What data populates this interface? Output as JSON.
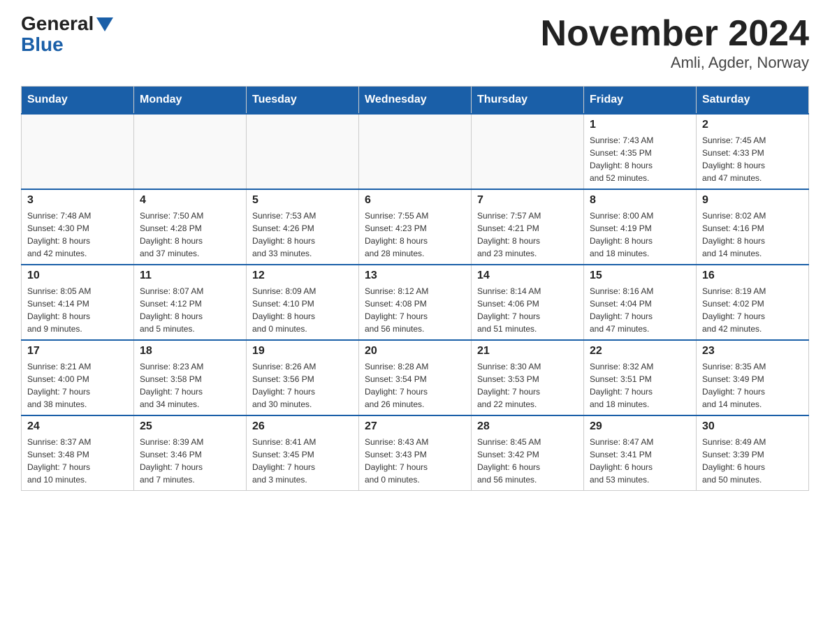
{
  "logo": {
    "general": "General",
    "blue": "Blue"
  },
  "title": "November 2024",
  "subtitle": "Amli, Agder, Norway",
  "days_of_week": [
    "Sunday",
    "Monday",
    "Tuesday",
    "Wednesday",
    "Thursday",
    "Friday",
    "Saturday"
  ],
  "weeks": [
    [
      {
        "day": "",
        "info": ""
      },
      {
        "day": "",
        "info": ""
      },
      {
        "day": "",
        "info": ""
      },
      {
        "day": "",
        "info": ""
      },
      {
        "day": "",
        "info": ""
      },
      {
        "day": "1",
        "info": "Sunrise: 7:43 AM\nSunset: 4:35 PM\nDaylight: 8 hours\nand 52 minutes."
      },
      {
        "day": "2",
        "info": "Sunrise: 7:45 AM\nSunset: 4:33 PM\nDaylight: 8 hours\nand 47 minutes."
      }
    ],
    [
      {
        "day": "3",
        "info": "Sunrise: 7:48 AM\nSunset: 4:30 PM\nDaylight: 8 hours\nand 42 minutes."
      },
      {
        "day": "4",
        "info": "Sunrise: 7:50 AM\nSunset: 4:28 PM\nDaylight: 8 hours\nand 37 minutes."
      },
      {
        "day": "5",
        "info": "Sunrise: 7:53 AM\nSunset: 4:26 PM\nDaylight: 8 hours\nand 33 minutes."
      },
      {
        "day": "6",
        "info": "Sunrise: 7:55 AM\nSunset: 4:23 PM\nDaylight: 8 hours\nand 28 minutes."
      },
      {
        "day": "7",
        "info": "Sunrise: 7:57 AM\nSunset: 4:21 PM\nDaylight: 8 hours\nand 23 minutes."
      },
      {
        "day": "8",
        "info": "Sunrise: 8:00 AM\nSunset: 4:19 PM\nDaylight: 8 hours\nand 18 minutes."
      },
      {
        "day": "9",
        "info": "Sunrise: 8:02 AM\nSunset: 4:16 PM\nDaylight: 8 hours\nand 14 minutes."
      }
    ],
    [
      {
        "day": "10",
        "info": "Sunrise: 8:05 AM\nSunset: 4:14 PM\nDaylight: 8 hours\nand 9 minutes."
      },
      {
        "day": "11",
        "info": "Sunrise: 8:07 AM\nSunset: 4:12 PM\nDaylight: 8 hours\nand 5 minutes."
      },
      {
        "day": "12",
        "info": "Sunrise: 8:09 AM\nSunset: 4:10 PM\nDaylight: 8 hours\nand 0 minutes."
      },
      {
        "day": "13",
        "info": "Sunrise: 8:12 AM\nSunset: 4:08 PM\nDaylight: 7 hours\nand 56 minutes."
      },
      {
        "day": "14",
        "info": "Sunrise: 8:14 AM\nSunset: 4:06 PM\nDaylight: 7 hours\nand 51 minutes."
      },
      {
        "day": "15",
        "info": "Sunrise: 8:16 AM\nSunset: 4:04 PM\nDaylight: 7 hours\nand 47 minutes."
      },
      {
        "day": "16",
        "info": "Sunrise: 8:19 AM\nSunset: 4:02 PM\nDaylight: 7 hours\nand 42 minutes."
      }
    ],
    [
      {
        "day": "17",
        "info": "Sunrise: 8:21 AM\nSunset: 4:00 PM\nDaylight: 7 hours\nand 38 minutes."
      },
      {
        "day": "18",
        "info": "Sunrise: 8:23 AM\nSunset: 3:58 PM\nDaylight: 7 hours\nand 34 minutes."
      },
      {
        "day": "19",
        "info": "Sunrise: 8:26 AM\nSunset: 3:56 PM\nDaylight: 7 hours\nand 30 minutes."
      },
      {
        "day": "20",
        "info": "Sunrise: 8:28 AM\nSunset: 3:54 PM\nDaylight: 7 hours\nand 26 minutes."
      },
      {
        "day": "21",
        "info": "Sunrise: 8:30 AM\nSunset: 3:53 PM\nDaylight: 7 hours\nand 22 minutes."
      },
      {
        "day": "22",
        "info": "Sunrise: 8:32 AM\nSunset: 3:51 PM\nDaylight: 7 hours\nand 18 minutes."
      },
      {
        "day": "23",
        "info": "Sunrise: 8:35 AM\nSunset: 3:49 PM\nDaylight: 7 hours\nand 14 minutes."
      }
    ],
    [
      {
        "day": "24",
        "info": "Sunrise: 8:37 AM\nSunset: 3:48 PM\nDaylight: 7 hours\nand 10 minutes."
      },
      {
        "day": "25",
        "info": "Sunrise: 8:39 AM\nSunset: 3:46 PM\nDaylight: 7 hours\nand 7 minutes."
      },
      {
        "day": "26",
        "info": "Sunrise: 8:41 AM\nSunset: 3:45 PM\nDaylight: 7 hours\nand 3 minutes."
      },
      {
        "day": "27",
        "info": "Sunrise: 8:43 AM\nSunset: 3:43 PM\nDaylight: 7 hours\nand 0 minutes."
      },
      {
        "day": "28",
        "info": "Sunrise: 8:45 AM\nSunset: 3:42 PM\nDaylight: 6 hours\nand 56 minutes."
      },
      {
        "day": "29",
        "info": "Sunrise: 8:47 AM\nSunset: 3:41 PM\nDaylight: 6 hours\nand 53 minutes."
      },
      {
        "day": "30",
        "info": "Sunrise: 8:49 AM\nSunset: 3:39 PM\nDaylight: 6 hours\nand 50 minutes."
      }
    ]
  ]
}
